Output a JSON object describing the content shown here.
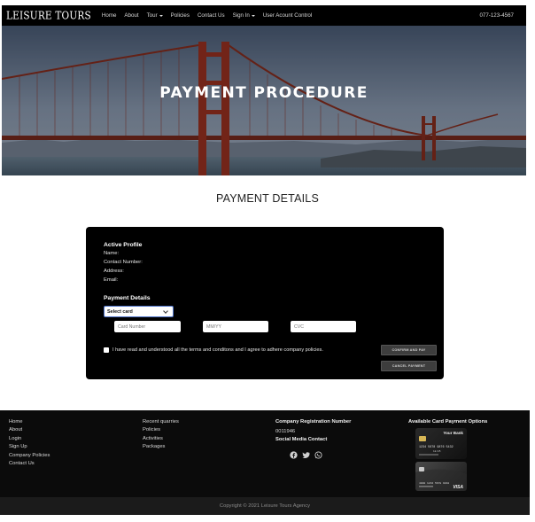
{
  "navbar": {
    "brand": "LEISURE TOURS",
    "links": [
      "Home",
      "About",
      "Tour",
      "Policies",
      "Contact Us",
      "Sign In",
      "User Acount Control"
    ],
    "phone": "077-123-4567"
  },
  "hero": {
    "title": "PAYMENT PROCEDURE"
  },
  "section": {
    "title": "PAYMENT DETAILS"
  },
  "payment": {
    "profile_heading": "Active Profile",
    "profile_fields": [
      "Name:",
      "Contact Number:",
      "Address:",
      "Email:"
    ],
    "details_heading": "Payment Details",
    "select_value": "Select card",
    "card_number_placeholder": "Card Number",
    "expiry_placeholder": "MM/YY",
    "cvc_placeholder": "CVC",
    "terms_text": "I have read and understood all the terms and conditons and I agree to adhere company policies.",
    "confirm_label": "CONFIRM AND PAY",
    "cancel_label": "CANCEL PAYMENT"
  },
  "footer": {
    "col1": [
      "Home",
      "About",
      "Login",
      "Sign Up",
      "Company Policies",
      "Contact Us"
    ],
    "col2": [
      "Recent quarries",
      "Policies",
      "Activities",
      "Packages"
    ],
    "reg_heading": "Company Registration Number",
    "reg_number": "0011946",
    "social_heading": "Social Media Contact",
    "social_icons": [
      "facebook-icon",
      "twitter-icon",
      "whatsapp-icon"
    ],
    "cards_heading": "Available Card Payment Options",
    "card1": {
      "bank": "Your Bank",
      "number": "1234 5678 9876 5432",
      "expiry": "12/25"
    },
    "card2": {
      "brand": "VISA",
      "number": "4000 1234 5678 9010"
    },
    "copyright": "Copyright © 2021 Leisure Tours Agency"
  }
}
